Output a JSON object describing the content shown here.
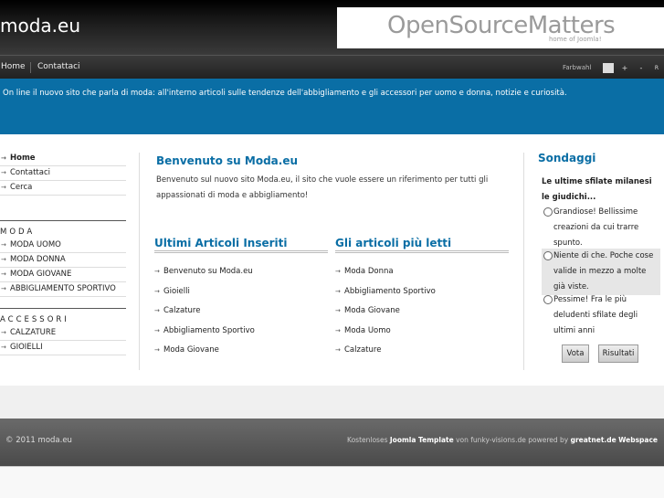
{
  "header": {
    "site_title": "moda.eu",
    "banner_main": "OpenSourceMatters",
    "banner_sub": "home of Joomla!"
  },
  "topnav": {
    "items": [
      "Home",
      "Contattaci"
    ],
    "farbwahl": "Farbwahl",
    "controls": [
      "+",
      "-",
      "R"
    ]
  },
  "intro": "On line il nuovo sito che parla di moda: all'interno articoli sulle tendenze dell'abbigliamento e gli accessori per uomo e donna, notizie e curiosità.",
  "left_menu": {
    "main": [
      "Home",
      "Contattaci",
      "Cerca"
    ],
    "moda_heading": "MODA",
    "moda": [
      "MODA UOMO",
      "MODA DONNA",
      "MODA GIOVANE",
      "ABBIGLIAMENTO SPORTIVO"
    ],
    "accessori_heading": "ACCESSORI",
    "accessori": [
      "CALZATURE",
      "GIOIELLI"
    ]
  },
  "welcome": {
    "title": "Benvenuto su Moda.eu",
    "text": "Benvenuto sul nuovo sito Moda.eu, il sito che vuole essere un riferimento per tutti gli appassionati di moda e abbigliamento!"
  },
  "latest": {
    "title": "Ultimi Articoli Inseriti",
    "items": [
      "Benvenuto su Moda.eu",
      "Gioielli",
      "Calzature",
      "Abbigliamento Sportivo",
      "Moda Giovane"
    ]
  },
  "popular": {
    "title": "Gli articoli più letti",
    "items": [
      "Moda Donna",
      "Abbigliamento Sportivo",
      "Moda Giovane",
      "Moda Uomo",
      "Calzature"
    ]
  },
  "poll": {
    "title": "Sondaggi",
    "question": "Le ultime sfilate milanesi le giudichi...",
    "options": [
      "Grandiose! Bellissime creazioni da cui trarre spunto.",
      "Niente di che. Poche cose valide in mezzo a molte già viste.",
      "Pessime! Fra le più deludenti sfilate degli ultimi anni"
    ],
    "vote_label": "Vota",
    "results_label": "Risultati"
  },
  "footer": {
    "copyright": "© 2011 moda.eu",
    "credits_prefix": "Kostenloses ",
    "credits_template": "Joomla Template",
    "credits_middle": " von funky-visions.de powered by ",
    "credits_greatnet": "greatnet.de",
    "credits_webspace": "Webspace"
  },
  "colors": {
    "accent": "#0a6ea5",
    "header_bg": "#111111",
    "footer_bg": "#555555"
  }
}
